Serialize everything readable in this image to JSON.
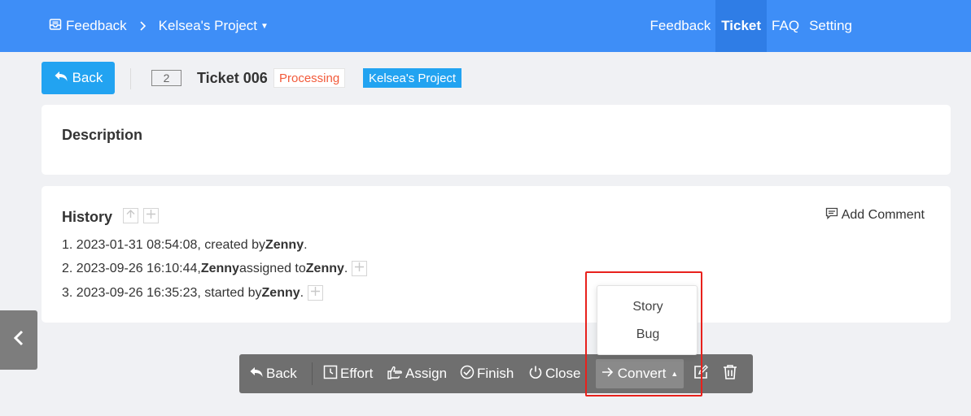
{
  "nav": {
    "brand": "Feedback",
    "project": "Kelsea's Project",
    "items": [
      {
        "label": "Feedback",
        "active": false
      },
      {
        "label": "Ticket",
        "active": true
      },
      {
        "label": "FAQ",
        "active": false
      },
      {
        "label": "Setting",
        "active": false
      }
    ]
  },
  "header": {
    "back_label": "Back",
    "ticket_number": "2",
    "ticket_title": "Ticket 006",
    "status": "Processing",
    "project_tag": "Kelsea's Project"
  },
  "description": {
    "title": "Description"
  },
  "history": {
    "title": "History",
    "add_comment": "Add Comment",
    "entries": [
      {
        "prefix": "1. 2023-01-31 08:54:08, created by ",
        "user": "Zenny",
        "suffix": " ."
      },
      {
        "prefix": "2. 2023-09-26 16:10:44, ",
        "user": "Zenny",
        "middle": " assigned to ",
        "user2": "Zenny",
        "suffix": "."
      },
      {
        "prefix": "3. 2023-09-26 16:35:23, started by ",
        "user": "Zenny",
        "suffix": "."
      }
    ]
  },
  "toolbar": {
    "back": "Back",
    "effort": "Effort",
    "assign": "Assign",
    "finish": "Finish",
    "close": "Close",
    "convert": "Convert"
  },
  "convert_menu": {
    "items": [
      "Story",
      "Bug"
    ]
  },
  "colors": {
    "nav_bg": "#3e8ef7",
    "primary_button": "#22a3f1",
    "status_text": "#f25a3a",
    "toolbar_bg": "#6f6f6f",
    "highlight": "#e8211c"
  }
}
